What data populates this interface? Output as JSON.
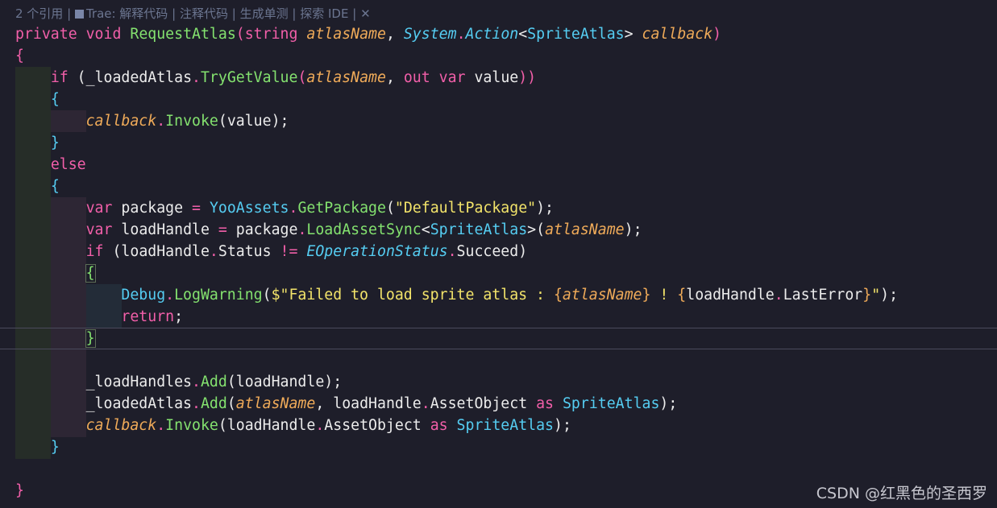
{
  "codelens": {
    "references": "2 个引用",
    "trae_prefix": "Trae: 解释代码",
    "comment": "注释代码",
    "tests": "生成单测",
    "explore": "探索 IDE",
    "close": "✕",
    "sep": "|"
  },
  "code": {
    "l1": {
      "t1": "private",
      "t2": "void",
      "t3": "RequestAtlas",
      "t4": "(",
      "t5": "string",
      "t6": "atlasName",
      ",": ",",
      "t7": "System",
      "t8": ".",
      "t9": "Action",
      "t10": "<",
      "t11": "SpriteAtlas",
      "t12": ">",
      "t13": "callback",
      "t14": ")"
    },
    "l2": {
      "t1": "{"
    },
    "l3": {
      "t1": "if",
      "t2": " (",
      "t3": "_loadedAtlas",
      "t4": ".",
      "t5": "TryGetValue",
      "t6": "(",
      "t7": "atlasName",
      "t8": ",",
      "t9": "out",
      "t10": "var",
      "t11": "value",
      "t12": "))"
    },
    "l4": {
      "t1": "{"
    },
    "l5": {
      "t1": "callback",
      "t2": ".",
      "t3": "Invoke",
      "t4": "(",
      "t5": "value",
      "t6": ");"
    },
    "l6": {
      "t1": "}"
    },
    "l7": {
      "t1": "else"
    },
    "l8": {
      "t1": "{"
    },
    "l9": {
      "t1": "var",
      "t2": "package",
      "t3": "=",
      "t4": "YooAssets",
      "t5": ".",
      "t6": "GetPackage",
      "t7": "(",
      "t8": "\"DefaultPackage\"",
      "t9": ");"
    },
    "l10": {
      "t1": "var",
      "t2": "loadHandle",
      "t3": "=",
      "t4": "package",
      "t5": ".",
      "t6": "LoadAssetSync",
      "t7": "<",
      "t8": "SpriteAtlas",
      "t9": ">(",
      "t10": "atlasName",
      "t11": ");"
    },
    "l11": {
      "t1": "if",
      "t2": " (",
      "t3": "loadHandle",
      "t4": ".",
      "t5": "Status",
      "t6": "!=",
      "t7": "EOperationStatus",
      "t8": ".",
      "t9": "Succeed",
      "t10": ")"
    },
    "l12": {
      "t1": "{"
    },
    "l13": {
      "t1": "Debug",
      "t2": ".",
      "t3": "LogWarning",
      "t4": "(",
      "t5": "$\"Failed to load sprite atlas : ",
      "t6": "{",
      "t7": "atlasName",
      "t8": "}",
      "t9": " ! ",
      "t10": "{",
      "t11": "loadHandle",
      "t12": ".",
      "t13": "LastError",
      "t14": "}",
      "t15": "\"",
      "t16": ");"
    },
    "l14": {
      "t1": "return",
      "t2": ";"
    },
    "l15": {
      "t1": "}"
    },
    "l16": {
      "t1": "_loadHandles",
      "t2": ".",
      "t3": "Add",
      "t4": "(",
      "t5": "loadHandle",
      "t6": ");"
    },
    "l17": {
      "t1": "_loadedAtlas",
      "t2": ".",
      "t3": "Add",
      "t4": "(",
      "t5": "atlasName",
      "t6": ",",
      "t7": "loadHandle",
      "t8": ".",
      "t9": "AssetObject",
      "t10": "as",
      "t11": "SpriteAtlas",
      "t12": ");"
    },
    "l18": {
      "t1": "callback",
      "t2": ".",
      "t3": "Invoke",
      "t4": "(",
      "t5": "loadHandle",
      "t6": ".",
      "t7": "AssetObject",
      "t8": "as",
      "t9": "SpriteAtlas",
      "t10": ");"
    },
    "l19": {
      "t1": "}"
    },
    "l20": {
      "t1": "}"
    }
  },
  "watermark": "CSDN @红黑色的圣西罗"
}
